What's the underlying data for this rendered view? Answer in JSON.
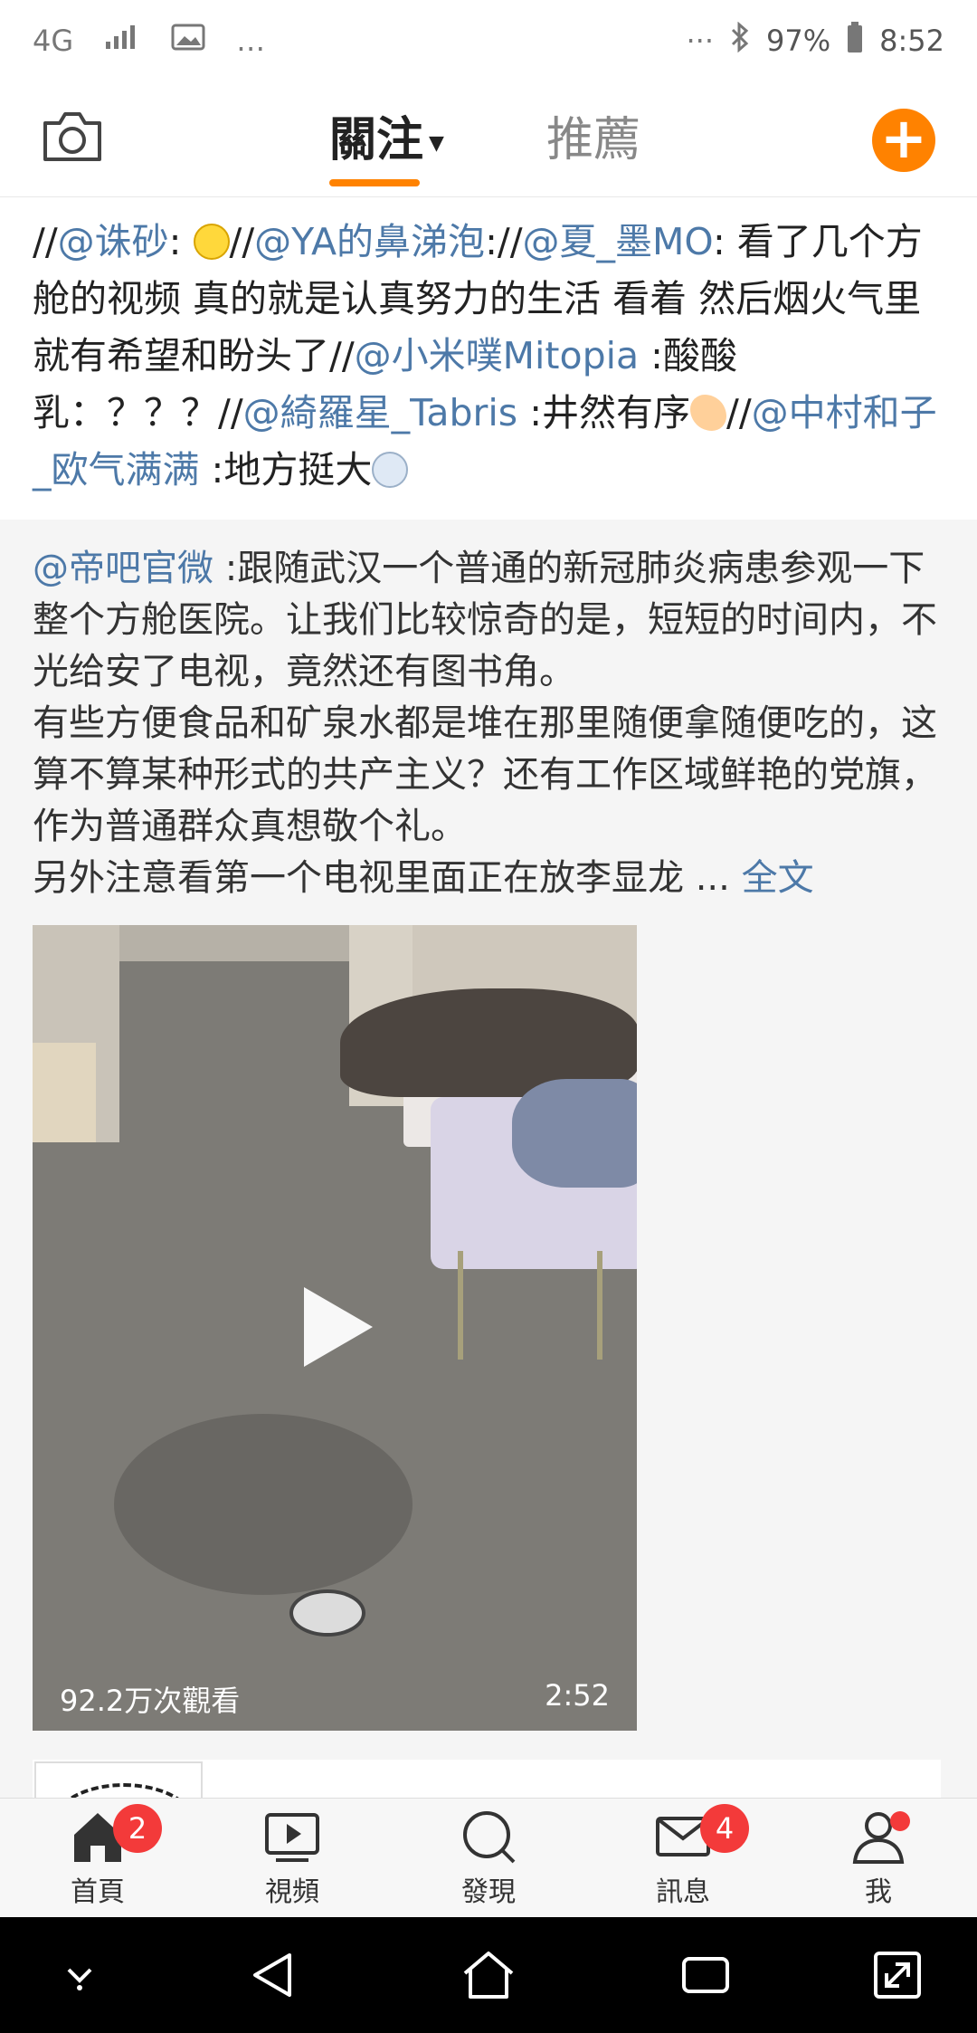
{
  "status_bar": {
    "network": "4G",
    "extra": "…",
    "right_dots": "···",
    "battery": "97%",
    "time": "8:52"
  },
  "top_nav": {
    "tab_follow": "關注",
    "tab_recommend": "推薦"
  },
  "repost": {
    "segments": [
      {
        "t": "//",
        "m": false
      },
      {
        "t": "@诛砂",
        "m": true
      },
      {
        "t": ": ",
        "m": false
      },
      {
        "t": "//",
        "m": false
      },
      {
        "t": "@YA的鼻涕泡",
        "m": true
      },
      {
        "t": "://",
        "m": false
      },
      {
        "t": "@夏_墨MO",
        "m": true
      },
      {
        "t": ": 看了几个方舱的视频 真的就是认真努力的生活 看着 然后烟火气里就有希望和盼头了//",
        "m": false
      },
      {
        "t": "@小米噗Mitopia",
        "m": true
      },
      {
        "t": " :酸酸乳：？？？//",
        "m": false
      },
      {
        "t": "@綺羅星_Tabris",
        "m": true
      },
      {
        "t": " :井然有序",
        "m": false
      },
      {
        "t": "//",
        "m": false
      },
      {
        "t": "@中村和子_欧气满满",
        "m": true
      },
      {
        "t": " :地方挺大",
        "m": false
      }
    ]
  },
  "original": {
    "author": "@帝吧官微",
    "line1": " :跟随武汉一个普通的新冠肺炎病患参观一下整个方舱医院。让我们比较惊奇的是，短短的时间内，不光给安了电视，竟然还有图书角。",
    "line2": "有些方便食品和矿泉水都是堆在那里随便拿随便吃的，这算不算某种形式的共产主义？还有工作区域鲜艳的党旗，作为普通群众真想敬个礼。",
    "line3": "另外注意看第一个电视里面正在放李显龙 ... ",
    "full_text": "全文"
  },
  "video": {
    "views": "92.2万次觀看",
    "duration": "2:52"
  },
  "tab_bar": {
    "home": "首頁",
    "home_badge": "2",
    "video": "視頻",
    "discover": "發現",
    "messages": "訊息",
    "messages_badge": "4",
    "me": "我"
  },
  "colors": {
    "accent": "#ff8200",
    "mention": "#4d79a8",
    "badge": "#f33a3a"
  }
}
